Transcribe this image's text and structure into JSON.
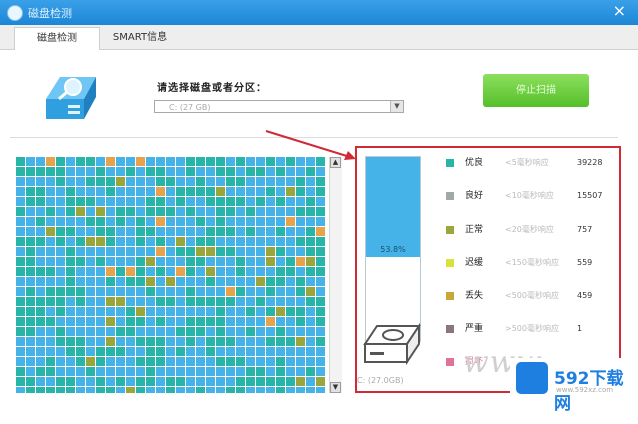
{
  "window": {
    "title": "磁盘检测",
    "close_label": "×"
  },
  "tabs": [
    {
      "label": "磁盘检测"
    },
    {
      "label": "SMART信息"
    }
  ],
  "header": {
    "prompt": "请选择磁盘或者分区：",
    "select_value": "C:  (27 GB)",
    "select_arrow": "▼",
    "stop_button": "停止扫描"
  },
  "usage": {
    "label": "53.8%",
    "fraction": 0.538
  },
  "drive_caption": "C: (27.0GB)",
  "legend": [
    {
      "name": "优良",
      "desc": "<5毫秒响应",
      "count": "39228",
      "color": "#27b5a9"
    },
    {
      "name": "良好",
      "desc": "<10毫秒响应",
      "count": "15507",
      "color": "#a0a8a8"
    },
    {
      "name": "正常",
      "desc": "<20毫秒响应",
      "count": "757",
      "color": "#9aa63a"
    },
    {
      "name": "迟缓",
      "desc": "<150毫秒响应",
      "count": "559",
      "color": "#d7e33a"
    },
    {
      "name": "丢失",
      "desc": "<500毫秒响应",
      "count": "459",
      "color": "#c6a93a"
    },
    {
      "name": "严重",
      "desc": ">500毫秒响应",
      "count": "1",
      "color": "#8a7580"
    },
    {
      "name": "损坏",
      "desc": "",
      "count": "",
      "color": "#e0739a"
    }
  ],
  "scrollbar": {
    "up": "▲",
    "down": "▼"
  },
  "watermark": {
    "site": "www",
    "brand": "592下载网",
    "url": "www.592xz.com"
  },
  "cell_colors": [
    "#46b3e8",
    "#27b5a9",
    "#9aa63a",
    "#e8a24a",
    "#a0a8a8"
  ]
}
